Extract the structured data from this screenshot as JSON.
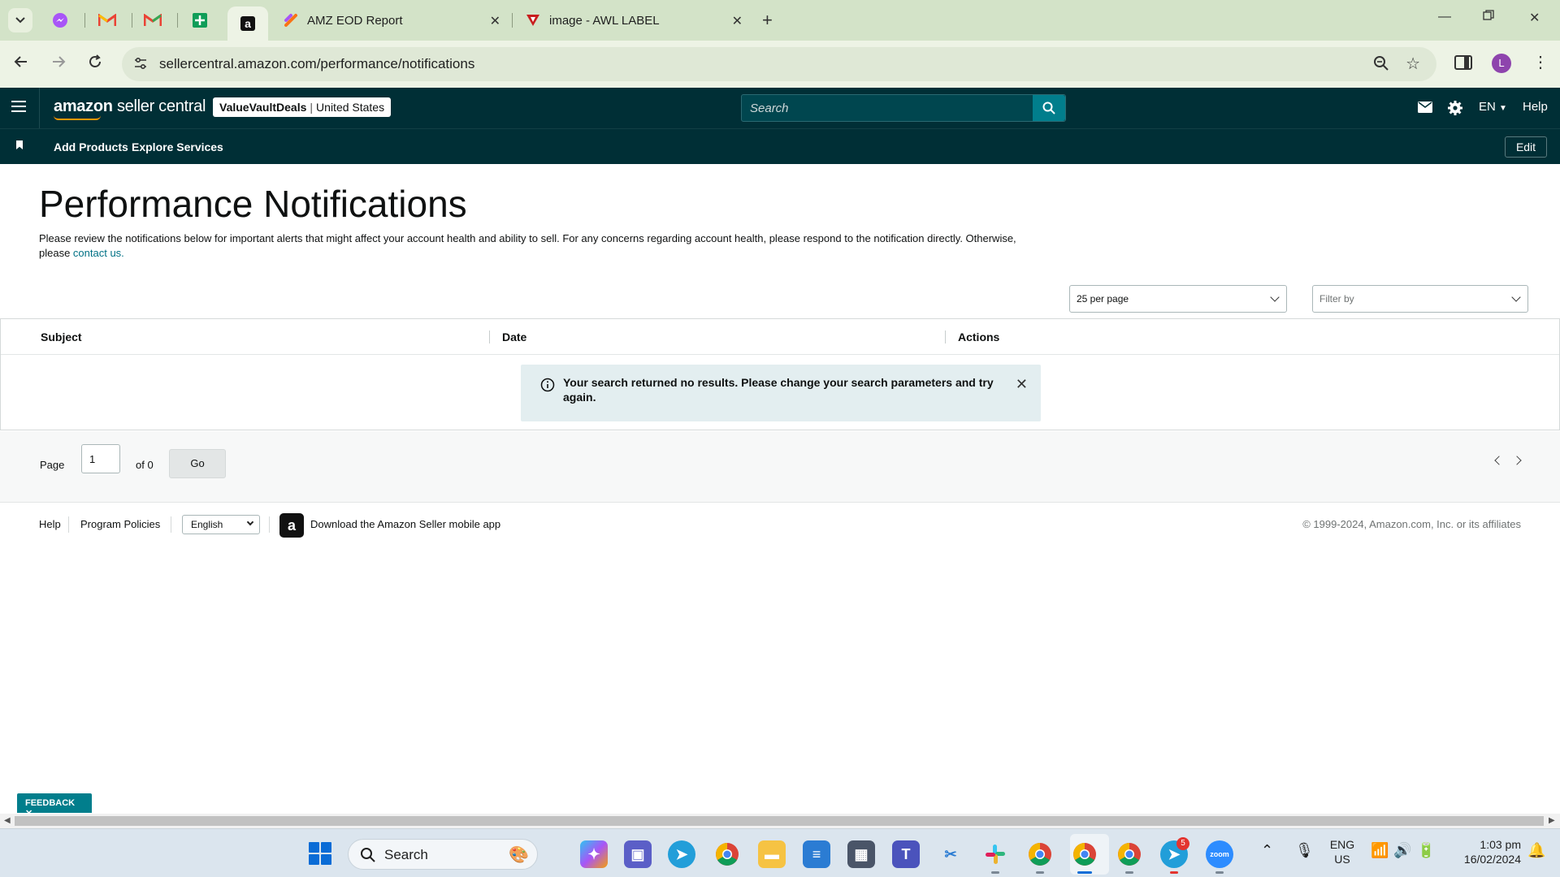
{
  "browser": {
    "tabs": [
      {
        "title": "AMZ EOD Report"
      },
      {
        "title": "image - AWL LABEL"
      }
    ],
    "url": "sellercentral.amazon.com/performance/notifications",
    "profile_initial": "L"
  },
  "header": {
    "logo_brand": "amazon",
    "logo_product": "seller central",
    "store_name": "ValueVaultDeals",
    "store_separator": "|",
    "marketplace": "United States",
    "search_placeholder": "Search",
    "language": "EN",
    "help": "Help"
  },
  "subnav": {
    "links": [
      "Add Products",
      "Explore Services"
    ],
    "edit": "Edit"
  },
  "main": {
    "title": "Performance Notifications",
    "description_prefix": "Please review the notifications below for important alerts that might affect your account health and ability to sell. For any concerns regarding account health, please respond to the notification directly. Otherwise, please ",
    "description_link": "contact us.",
    "per_page": "25 per page",
    "filter_placeholder": "Filter by",
    "columns": [
      "Subject",
      "Date",
      "Actions"
    ],
    "empty_message": "Your search returned no results. Please change your search parameters and try again.",
    "pager": {
      "page_label": "Page",
      "page_value": "1",
      "of_label": "of 0",
      "go": "Go"
    }
  },
  "footer": {
    "help": "Help",
    "program_policies": "Program Policies",
    "language": "English",
    "app_text": "Download the Amazon Seller mobile app",
    "copyright": "© 1999-2024, Amazon.com, Inc. or its affiliates"
  },
  "feedback": "FEEDBACK ✕",
  "taskbar": {
    "search": "Search",
    "telegram_badge": "5",
    "lang_top": "ENG",
    "lang_bottom": "US",
    "time": "1:03 pm",
    "date": "16/02/2024"
  },
  "colors": {
    "header_bg": "#002f36",
    "search_button": "#017e8c",
    "link": "#007185",
    "alert_bg": "#e3eef0",
    "browser_chrome": "#d3e3c8"
  }
}
